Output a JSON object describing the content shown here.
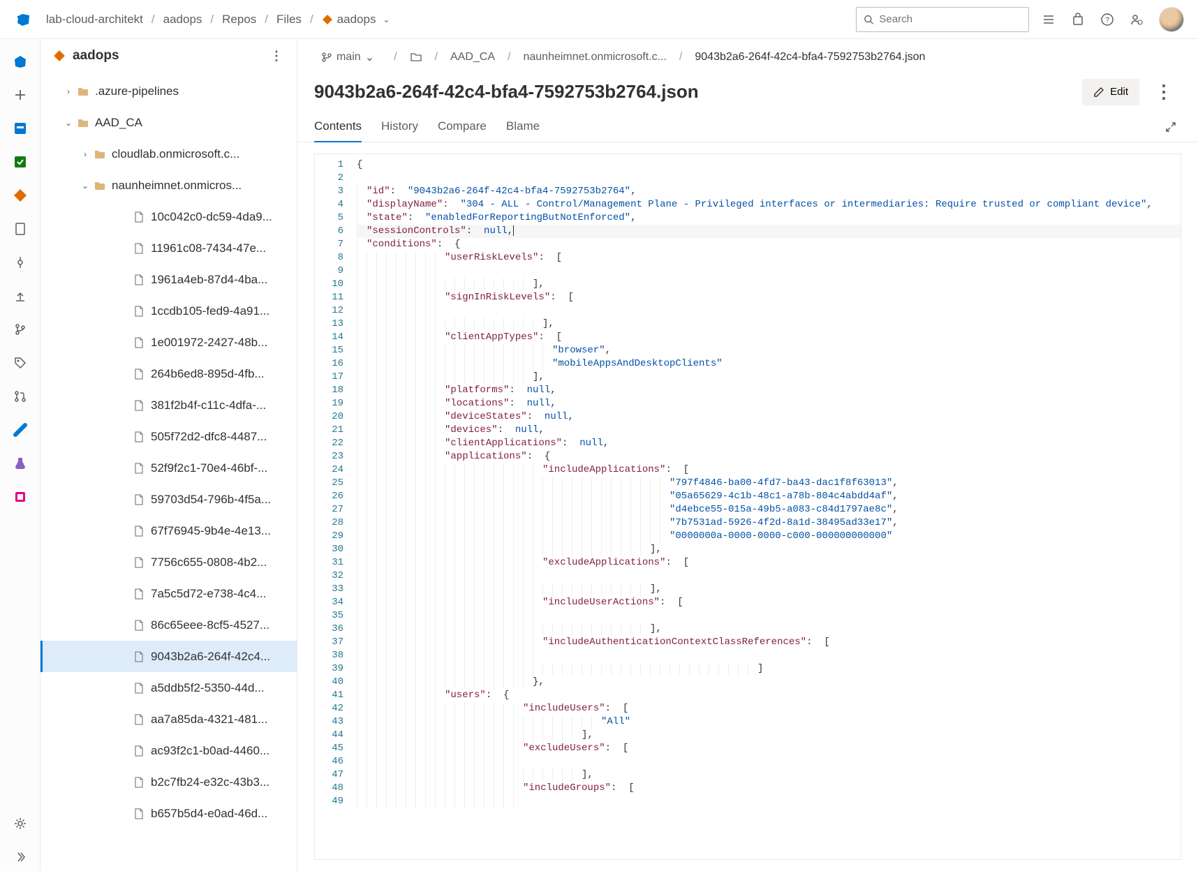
{
  "header": {
    "breadcrumbs": [
      "lab-cloud-architekt",
      "aadops",
      "Repos",
      "Files",
      "aadops"
    ],
    "search_placeholder": "Search",
    "avatar_initial": ""
  },
  "explorer": {
    "repo_name": "aadops",
    "tree_top": [
      {
        "type": "folder",
        "label": ".azure-pipelines",
        "expanded": false,
        "depth": 1
      },
      {
        "type": "folder",
        "label": "AAD_CA",
        "expanded": true,
        "depth": 1
      },
      {
        "type": "folder",
        "label": "cloudlab.onmicrosoft.c...",
        "expanded": false,
        "depth": 2
      },
      {
        "type": "folder",
        "label": "naunheimnet.onmicros...",
        "expanded": true,
        "depth": 2
      }
    ],
    "files": [
      "10c042c0-dc59-4da9...",
      "11961c08-7434-47e...",
      "1961a4eb-87d4-4ba...",
      "1ccdb105-fed9-4a91...",
      "1e001972-2427-48b...",
      "264b6ed8-895d-4fb...",
      "381f2b4f-c11c-4dfa-...",
      "505f72d2-dfc8-4487...",
      "52f9f2c1-70e4-46bf-...",
      "59703d54-796b-4f5a...",
      "67f76945-9b4e-4e13...",
      "7756c655-0808-4b2...",
      "7a5c5d72-e738-4c4...",
      "86c65eee-8cf5-4527...",
      "9043b2a6-264f-42c4...",
      "a5ddb5f2-5350-44d...",
      "aa7a85da-4321-481...",
      "ac93f2c1-b0ad-4460...",
      "b2c7fb24-e32c-43b3...",
      "b657b5d4-e0ad-46d..."
    ],
    "selected_file_index": 14
  },
  "content": {
    "branch": "main",
    "path": [
      "AAD_CA",
      "naunheimnet.onmicrosoft.c...",
      "9043b2a6-264f-42c4-bfa4-7592753b2764.json"
    ],
    "title": "9043b2a6-264f-42c4-bfa4-7592753b2764.json",
    "edit_label": "Edit",
    "tabs": [
      "Contents",
      "History",
      "Compare",
      "Blame"
    ],
    "active_tab_index": 0,
    "code_lines": [
      {
        "n": 1,
        "i": 0,
        "t": [
          [
            "punc",
            "{"
          ]
        ]
      },
      {
        "n": 2,
        "i": 0,
        "t": []
      },
      {
        "n": 3,
        "i": 1,
        "t": [
          [
            "key",
            "\"id\""
          ],
          [
            "punc",
            ":  "
          ],
          [
            "str",
            "\"9043b2a6-264f-42c4-bfa4-7592753b2764\""
          ],
          [
            "punc",
            ","
          ]
        ]
      },
      {
        "n": 4,
        "i": 1,
        "t": [
          [
            "key",
            "\"displayName\""
          ],
          [
            "punc",
            ":  "
          ],
          [
            "str",
            "\"304 - ALL - Control/Management Plane - Privileged interfaces or intermediaries: Require trusted or compliant device\""
          ],
          [
            "punc",
            ","
          ]
        ]
      },
      {
        "n": 5,
        "i": 1,
        "t": [
          [
            "key",
            "\"state\""
          ],
          [
            "punc",
            ":  "
          ],
          [
            "str",
            "\"enabledForReportingButNotEnforced\""
          ],
          [
            "punc",
            ","
          ]
        ]
      },
      {
        "n": 6,
        "i": 1,
        "t": [
          [
            "key",
            "\"sessionControls\""
          ],
          [
            "punc",
            ":  "
          ],
          [
            "null",
            "null"
          ],
          [
            "punc",
            ","
          ]
        ],
        "cursor": true
      },
      {
        "n": 7,
        "i": 1,
        "t": [
          [
            "key",
            "\"conditions\""
          ],
          [
            "punc",
            ":  {"
          ]
        ]
      },
      {
        "n": 8,
        "i": 9,
        "t": [
          [
            "key",
            "\"userRiskLevels\""
          ],
          [
            "punc",
            ":  ["
          ]
        ]
      },
      {
        "n": 9,
        "i": 9,
        "t": []
      },
      {
        "n": 10,
        "i": 18,
        "t": [
          [
            "punc",
            "],"
          ]
        ]
      },
      {
        "n": 11,
        "i": 9,
        "t": [
          [
            "key",
            "\"signInRiskLevels\""
          ],
          [
            "punc",
            ":  ["
          ]
        ]
      },
      {
        "n": 12,
        "i": 9,
        "t": []
      },
      {
        "n": 13,
        "i": 19,
        "t": [
          [
            "punc",
            "],"
          ]
        ]
      },
      {
        "n": 14,
        "i": 9,
        "t": [
          [
            "key",
            "\"clientAppTypes\""
          ],
          [
            "punc",
            ":  ["
          ]
        ]
      },
      {
        "n": 15,
        "i": 20,
        "t": [
          [
            "str",
            "\"browser\""
          ],
          [
            "punc",
            ","
          ]
        ]
      },
      {
        "n": 16,
        "i": 20,
        "t": [
          [
            "str",
            "\"mobileAppsAndDesktopClients\""
          ]
        ]
      },
      {
        "n": 17,
        "i": 18,
        "t": [
          [
            "punc",
            "],"
          ]
        ]
      },
      {
        "n": 18,
        "i": 9,
        "t": [
          [
            "key",
            "\"platforms\""
          ],
          [
            "punc",
            ":  "
          ],
          [
            "null",
            "null"
          ],
          [
            "punc",
            ","
          ]
        ]
      },
      {
        "n": 19,
        "i": 9,
        "t": [
          [
            "key",
            "\"locations\""
          ],
          [
            "punc",
            ":  "
          ],
          [
            "null",
            "null"
          ],
          [
            "punc",
            ","
          ]
        ]
      },
      {
        "n": 20,
        "i": 9,
        "t": [
          [
            "key",
            "\"deviceStates\""
          ],
          [
            "punc",
            ":  "
          ],
          [
            "null",
            "null"
          ],
          [
            "punc",
            ","
          ]
        ]
      },
      {
        "n": 21,
        "i": 9,
        "t": [
          [
            "key",
            "\"devices\""
          ],
          [
            "punc",
            ":  "
          ],
          [
            "null",
            "null"
          ],
          [
            "punc",
            ","
          ]
        ]
      },
      {
        "n": 22,
        "i": 9,
        "t": [
          [
            "key",
            "\"clientApplications\""
          ],
          [
            "punc",
            ":  "
          ],
          [
            "null",
            "null"
          ],
          [
            "punc",
            ","
          ]
        ]
      },
      {
        "n": 23,
        "i": 9,
        "t": [
          [
            "key",
            "\"applications\""
          ],
          [
            "punc",
            ":  {"
          ]
        ]
      },
      {
        "n": 24,
        "i": 19,
        "t": [
          [
            "key",
            "\"includeApplications\""
          ],
          [
            "punc",
            ":  ["
          ]
        ]
      },
      {
        "n": 25,
        "i": 32,
        "t": [
          [
            "str",
            "\"797f4846-ba00-4fd7-ba43-dac1f8f63013\""
          ],
          [
            "punc",
            ","
          ]
        ]
      },
      {
        "n": 26,
        "i": 32,
        "t": [
          [
            "str",
            "\"05a65629-4c1b-48c1-a78b-804c4abdd4af\""
          ],
          [
            "punc",
            ","
          ]
        ]
      },
      {
        "n": 27,
        "i": 32,
        "t": [
          [
            "str",
            "\"d4ebce55-015a-49b5-a083-c84d1797ae8c\""
          ],
          [
            "punc",
            ","
          ]
        ]
      },
      {
        "n": 28,
        "i": 32,
        "t": [
          [
            "str",
            "\"7b7531ad-5926-4f2d-8a1d-38495ad33e17\""
          ],
          [
            "punc",
            ","
          ]
        ]
      },
      {
        "n": 29,
        "i": 32,
        "t": [
          [
            "str",
            "\"0000000a-0000-0000-c000-000000000000\""
          ]
        ]
      },
      {
        "n": 30,
        "i": 30,
        "t": [
          [
            "punc",
            "],"
          ]
        ]
      },
      {
        "n": 31,
        "i": 19,
        "t": [
          [
            "key",
            "\"excludeApplications\""
          ],
          [
            "punc",
            ":  ["
          ]
        ]
      },
      {
        "n": 32,
        "i": 19,
        "t": []
      },
      {
        "n": 33,
        "i": 30,
        "t": [
          [
            "punc",
            "],"
          ]
        ]
      },
      {
        "n": 34,
        "i": 19,
        "t": [
          [
            "key",
            "\"includeUserActions\""
          ],
          [
            "punc",
            ":  ["
          ]
        ]
      },
      {
        "n": 35,
        "i": 19,
        "t": []
      },
      {
        "n": 36,
        "i": 30,
        "t": [
          [
            "punc",
            "],"
          ]
        ]
      },
      {
        "n": 37,
        "i": 19,
        "t": [
          [
            "key",
            "\"includeAuthenticationContextClassReferences\""
          ],
          [
            "punc",
            ":  ["
          ]
        ]
      },
      {
        "n": 38,
        "i": 19,
        "t": []
      },
      {
        "n": 39,
        "i": 41,
        "t": [
          [
            "punc",
            "]"
          ]
        ]
      },
      {
        "n": 40,
        "i": 18,
        "t": [
          [
            "punc",
            "},"
          ]
        ]
      },
      {
        "n": 41,
        "i": 9,
        "t": [
          [
            "key",
            "\"users\""
          ],
          [
            "punc",
            ":  {"
          ]
        ]
      },
      {
        "n": 42,
        "i": 17,
        "t": [
          [
            "key",
            "\"includeUsers\""
          ],
          [
            "punc",
            ":  ["
          ]
        ]
      },
      {
        "n": 43,
        "i": 25,
        "t": [
          [
            "str",
            "\"All\""
          ]
        ]
      },
      {
        "n": 44,
        "i": 23,
        "t": [
          [
            "punc",
            "],"
          ]
        ]
      },
      {
        "n": 45,
        "i": 17,
        "t": [
          [
            "key",
            "\"excludeUsers\""
          ],
          [
            "punc",
            ":  ["
          ]
        ]
      },
      {
        "n": 46,
        "i": 17,
        "t": []
      },
      {
        "n": 47,
        "i": 23,
        "t": [
          [
            "punc",
            "],"
          ]
        ]
      },
      {
        "n": 48,
        "i": 17,
        "t": [
          [
            "key",
            "\"includeGroups\""
          ],
          [
            "punc",
            ":  ["
          ]
        ]
      },
      {
        "n": 49,
        "i": 17,
        "t": []
      }
    ]
  }
}
